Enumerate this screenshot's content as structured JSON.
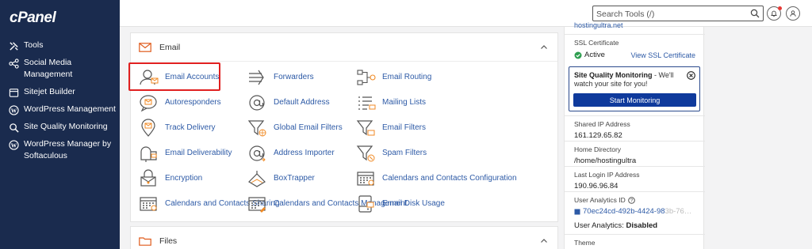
{
  "brand": {
    "logo": "cPanel"
  },
  "sidebar": {
    "items": [
      {
        "label": "Tools",
        "icon": "tools-icon"
      },
      {
        "label": "Social Media Management",
        "icon": "share-icon"
      },
      {
        "label": "Sitejet Builder",
        "icon": "sitejet-icon"
      },
      {
        "label": "WordPress Management",
        "icon": "wordpress-icon"
      },
      {
        "label": "Site Quality Monitoring",
        "icon": "magnifier-icon"
      },
      {
        "label": "WordPress Manager by Softaculous",
        "icon": "wordpress-icon"
      }
    ]
  },
  "topbar": {
    "search_placeholder": "Search Tools (/)",
    "notifications_icon": "bell-icon",
    "user_icon": "user-icon"
  },
  "email_section": {
    "title": "Email",
    "tools": [
      "Email Accounts",
      "Forwarders",
      "Email Routing",
      "Autoresponders",
      "Default Address",
      "Mailing Lists",
      "Track Delivery",
      "Global Email Filters",
      "Email Filters",
      "Email Deliverability",
      "Address Importer",
      "Spam Filters",
      "Encryption",
      "BoxTrapper",
      "Calendars and Contacts Configuration",
      "Calendars and Contacts Sharing",
      "Calendars and Contacts Management",
      "Email Disk Usage"
    ]
  },
  "files_section": {
    "title": "Files"
  },
  "info": {
    "domain_partial": "hostingultra.net",
    "ssl_label": "SSL Certificate",
    "ssl_status": "Active",
    "ssl_link": "View SSL Certificate",
    "monitor_title": "Site Quality Monitoring",
    "monitor_text": " - We'll watch your site for you!",
    "monitor_button": "Start Monitoring",
    "shared_ip_label": "Shared IP Address",
    "shared_ip": "161.129.65.82",
    "home_dir_label": "Home Directory",
    "home_dir": "/home/hostingultra",
    "last_login_label": "Last Login IP Address",
    "last_login": "190.96.96.84",
    "analytics_label": "User Analytics ID",
    "analytics_id": "70ec24cd-492b-4424-98",
    "analytics_fade": "3b-76…",
    "analytics_status_label": "User Analytics:",
    "analytics_status": "Disabled",
    "theme_label": "Theme"
  },
  "colors": {
    "sidebar": "#1a2b4e",
    "link": "#2d5aa6",
    "accent_orange": "#f08a24",
    "button": "#0f3a9c",
    "highlight": "#e02020",
    "success": "#2e9e4f"
  }
}
